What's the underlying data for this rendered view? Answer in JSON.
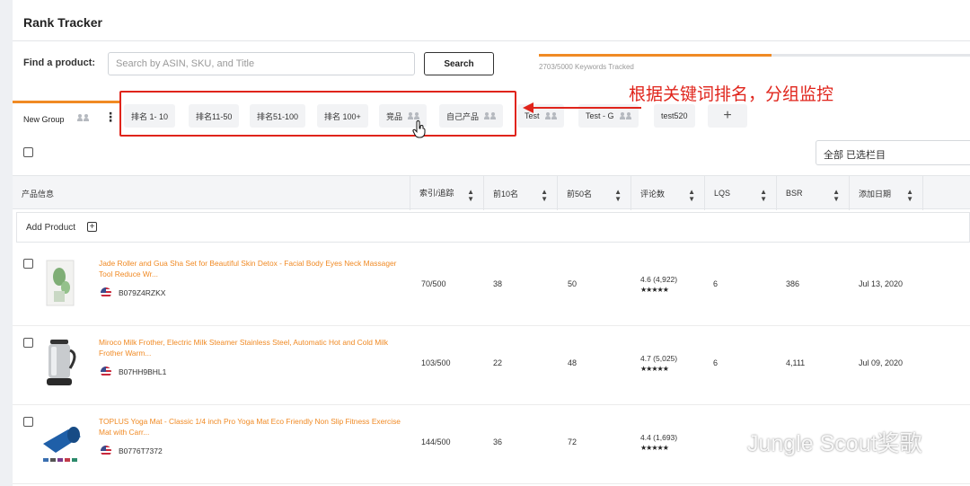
{
  "app": {
    "title": "Rank Tracker"
  },
  "search": {
    "label": "Find a product:",
    "placeholder": "Search by ASIN, SKU, and Title",
    "button": "Search"
  },
  "tracking": {
    "text": "2703/5000 Keywords Tracked",
    "used": 2703,
    "total": 5000
  },
  "group": {
    "name": "New Group"
  },
  "tabs": [
    {
      "label": "排名 1- 10",
      "shared": false
    },
    {
      "label": "排名11-50",
      "shared": false
    },
    {
      "label": "排名51-100",
      "shared": false
    },
    {
      "label": "排名 100+",
      "shared": false
    },
    {
      "label": "竞品",
      "shared": true
    },
    {
      "label": "自己产品",
      "shared": true
    },
    {
      "label": "Test",
      "shared": true
    },
    {
      "label": "Test - G",
      "shared": true
    },
    {
      "label": "test520",
      "shared": false
    }
  ],
  "annotation": "根据关键词排名，分组监控",
  "column_select": "全部 已选栏目",
  "table": {
    "headers": [
      "产品信息",
      "索引/追踪",
      "前10名",
      "前50名",
      "评论数",
      "LQS",
      "BSR",
      "添加日期"
    ],
    "add_product": "Add Product",
    "rows": [
      {
        "title": "Jade Roller and Gua Sha Set for Beautiful Skin Detox - Facial Body Eyes Neck Massager Tool Reduce Wr...",
        "asin": "B079Z4RZKX",
        "indexed": "70/500",
        "top10": "38",
        "top50": "50",
        "reviews": "4.6 (4,922)",
        "stars": "★★★★★",
        "lqs": "6",
        "bsr": "386",
        "date": "Jul 13, 2020"
      },
      {
        "title": "Miroco Milk Frother, Electric Milk Steamer Stainless Steel, Automatic Hot and Cold Milk Frother Warm...",
        "asin": "B07HH9BHL1",
        "indexed": "103/500",
        "top10": "22",
        "top50": "48",
        "reviews": "4.7 (5,025)",
        "stars": "★★★★★",
        "lqs": "6",
        "bsr": "4,111",
        "date": "Jul 09, 2020"
      },
      {
        "title": "TOPLUS Yoga Mat - Classic 1/4 inch Pro Yoga Mat Eco Friendly Non Slip Fitness Exercise Mat with Carr...",
        "asin": "B0776T7372",
        "indexed": "144/500",
        "top10": "36",
        "top50": "72",
        "reviews": "4.4 (1,693)",
        "stars": "★★★★★",
        "lqs": "",
        "bsr": "",
        "date": ""
      }
    ]
  },
  "watermark": "Jungle Scout奖歌",
  "colors": {
    "accent": "#f08a24",
    "annotation": "#e0241b"
  }
}
